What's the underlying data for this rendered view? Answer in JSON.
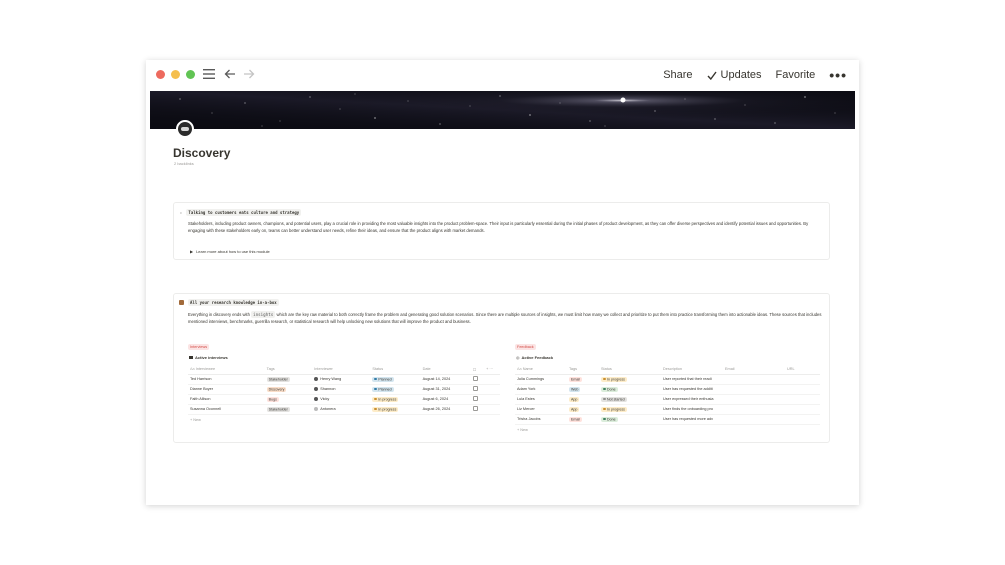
{
  "toolbar": {
    "share_label": "Share",
    "updates_label": "Updates",
    "favorite_label": "Favorite",
    "more_icon": "more-horizontal-icon"
  },
  "page": {
    "title": "Discovery",
    "backlinks": "2 backlinks"
  },
  "callout1": {
    "heading": "Talking to customers eats culture and strategy",
    "body": "Stakeholders, including product owners, champions, and potential users, play a crucial role in providing the most valuable insights into the product problem-space. Their input is particularly essential during the initial phases of product development, as they can offer diverse perspectives and identify potential issues and opportunities. By engaging with these stakeholders early on, teams can better understand user needs, refine their ideas, and ensure that the product aligns with market demands.",
    "toggle": "Learn more about how to use this module"
  },
  "callout2": {
    "heading": "All your research knowledge in-a-box",
    "body_pre": "Everything in discovery ends with",
    "body_code": "insights",
    "body_post": "which are the key raw material to both correctly frame the problem and generating good solution scenarios. Since there are multiple sources of insights, we must limit how many we collect and prioritize to put them into practice transforming them into actionable ideas. These sources that includes mentioned interviews, benchmarks, guerrilla research, or statistical research will help unlocking new solutions that will improve the product and business."
  },
  "interviews": {
    "label": "Interviews",
    "view_title": "Active interviews",
    "columns": [
      "Interviewee",
      "Tags",
      "Interviewer",
      "Status",
      "Date"
    ],
    "rows": [
      {
        "interviewee": "Ted Harrison",
        "tag": "Stakeholder",
        "interviewer": "Henry Wang",
        "status": "Planned",
        "date": "August 14, 2024"
      },
      {
        "interviewee": "Dianne Boyer",
        "tag": "Discovery",
        "interviewer": "Shannon",
        "status": "Planned",
        "date": "August 31, 2024"
      },
      {
        "interviewee": "Faith Allison",
        "tag": "Bugs",
        "interviewer": "Vicky",
        "status": "In progress",
        "date": "August 6, 2024"
      },
      {
        "interviewee": "Susanna Oconnell",
        "tag": "Stakeholder",
        "interviewer": "Antonera",
        "status": "In progress",
        "date": "August 26, 2024"
      }
    ],
    "new_label": "+ New"
  },
  "feedback": {
    "label": "Feedback",
    "view_title": "Active Feedback",
    "columns": [
      "Name",
      "Tags",
      "Status",
      "Description",
      "Email",
      "URL"
    ],
    "rows": [
      {
        "name": "Julia Cummings",
        "tag": "Email",
        "status": "In progress",
        "description": "User reported that their readi"
      },
      {
        "name": "Adam York",
        "tag": "Web",
        "status": "Done",
        "description": "User has requested the additi"
      },
      {
        "name": "Lula Estes",
        "tag": "App",
        "status": "Not started",
        "description": "User expressed their enthusia"
      },
      {
        "name": "Liz Mercer",
        "tag": "App",
        "status": "In progress",
        "description": "User finds the onboarding pro"
      },
      {
        "name": "Trisha Jacobs",
        "tag": "Email",
        "status": "Done",
        "description": "User has requested more adv"
      }
    ],
    "new_label": "+ New"
  },
  "colors": {
    "planned_bg": "#d3e5ef",
    "in_progress_bg": "#fdecc8",
    "done_bg": "#dbeddb",
    "not_started_bg": "#e3e2e0",
    "stakeholder_bg": "#e3e2e0",
    "discovery_bg": "#fadec9",
    "bugs_bg": "#ffe2dd",
    "email_bg": "#ffe2dd",
    "web_bg": "#d3e5ef",
    "app_bg": "#fdecc8"
  }
}
